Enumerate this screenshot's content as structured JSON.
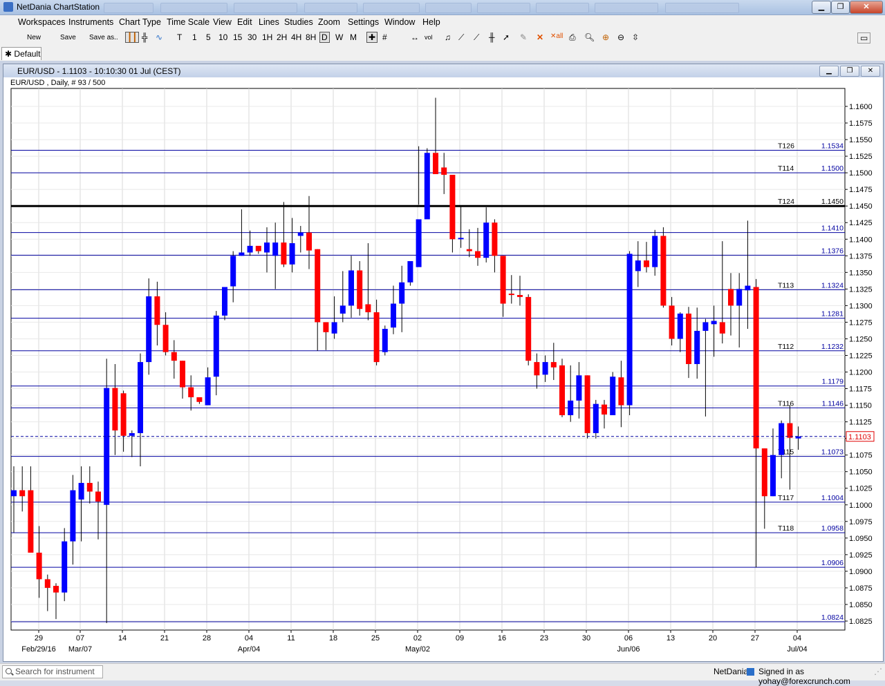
{
  "app": {
    "title": "NetDania ChartStation"
  },
  "menu": [
    "Workspaces",
    "Instruments",
    "Chart Type",
    "Time Scale",
    "View",
    "Edit",
    "Lines",
    "Studies",
    "Zoom",
    "Settings",
    "Window",
    "Help"
  ],
  "toolbar": {
    "new_label": "New",
    "save_label": "Save",
    "saveas_label": "Save as..",
    "periods": [
      "T",
      "1",
      "5",
      "10",
      "15",
      "30",
      "1H",
      "2H",
      "4H",
      "8H",
      "D",
      "W",
      "M"
    ],
    "selected_period": "D"
  },
  "workspace_tab": {
    "icon": "✱",
    "label": "Default"
  },
  "chart_window": {
    "title": "EUR/USD - 1.1103 - 10:10:30  01 Jul (CEST)",
    "subtitle": "EUR/USD , Daily, # 93 / 500"
  },
  "chart_data": {
    "type": "candlestick",
    "instrument": "EUR/USD",
    "ylim": [
      1.0815,
      1.1625
    ],
    "y_ticks": [
      "1.1600",
      "1.1575",
      "1.1550",
      "1.1525",
      "1.1500",
      "1.1475",
      "1.1450",
      "1.1425",
      "1.1400",
      "1.1375",
      "1.1350",
      "1.1325",
      "1.1300",
      "1.1275",
      "1.1250",
      "1.1225",
      "1.1200",
      "1.1175",
      "1.1150",
      "1.1125",
      "1.1100",
      "1.1075",
      "1.1050",
      "1.1025",
      "1.1000",
      "1.0975",
      "1.0950",
      "1.0925",
      "1.0900",
      "1.0875",
      "1.0850",
      "1.0825"
    ],
    "x_ticks": [
      "29",
      "07",
      "14",
      "21",
      "28",
      "04",
      "11",
      "18",
      "25",
      "02",
      "09",
      "16",
      "23",
      "30",
      "06",
      "13",
      "20",
      "27",
      "04"
    ],
    "x_sublabels": [
      {
        "at": "29",
        "text": "Feb/29/16"
      },
      {
        "at": "07",
        "text": "Mar/07"
      },
      {
        "at": "04",
        "text": "Apr/04"
      },
      {
        "at": "02",
        "text": "May/02"
      },
      {
        "at": "06",
        "text": "Jun/06"
      },
      {
        "at": "04b",
        "text": "Jul/04"
      }
    ],
    "last_price": "1.1103",
    "colors": {
      "up": "#0000ff",
      "down": "#ff0000",
      "line": "#0000a0",
      "bold_line": "#000000"
    },
    "hlines": [
      {
        "price": 1.1534,
        "label": "1.1534",
        "tag": "T126"
      },
      {
        "price": 1.15,
        "label": "1.1500",
        "tag": "T114"
      },
      {
        "price": 1.145,
        "label": "1.1450",
        "tag": "T124",
        "bold": true
      },
      {
        "price": 1.141,
        "label": "1.1410",
        "tag": ""
      },
      {
        "price": 1.1376,
        "label": "1.1376",
        "tag": ""
      },
      {
        "price": 1.1324,
        "label": "1.1324",
        "tag": "T113"
      },
      {
        "price": 1.1281,
        "label": "1.1281",
        "tag": ""
      },
      {
        "price": 1.1232,
        "label": "1.1232",
        "tag": "T112"
      },
      {
        "price": 1.1179,
        "label": "1.1179",
        "tag": ""
      },
      {
        "price": 1.1146,
        "label": "1.1146",
        "tag": "T116"
      },
      {
        "price": 1.1073,
        "label": "1.1073",
        "tag": "T115"
      },
      {
        "price": 1.1004,
        "label": "1.1004",
        "tag": "T117"
      },
      {
        "price": 1.0958,
        "label": "1.0958",
        "tag": "T118"
      },
      {
        "price": 1.0906,
        "label": "1.0906",
        "tag": ""
      },
      {
        "price": 1.0824,
        "label": "1.0824",
        "tag": ""
      }
    ],
    "candles": [
      [
        1.1013,
        1.1058,
        1.0958,
        1.1022
      ],
      [
        1.1022,
        1.1058,
        1.099,
        1.1013
      ],
      [
        1.1022,
        1.1058,
        1.093,
        1.0928
      ],
      [
        1.0928,
        1.0968,
        1.086,
        1.0888
      ],
      [
        1.0888,
        1.0895,
        1.084,
        1.0875
      ],
      [
        1.0878,
        1.0882,
        1.0828,
        1.0868
      ],
      [
        1.0868,
        1.0965,
        1.0855,
        1.0945
      ],
      [
        1.0945,
        1.1045,
        1.091,
        1.1022
      ],
      [
        1.1008,
        1.1058,
        1.0945,
        1.1033
      ],
      [
        1.1033,
        1.1058,
        1.1002,
        1.102
      ],
      [
        1.102,
        1.1035,
        1.0948,
        1.1005
      ],
      [
        1.1,
        1.122,
        1.0822,
        1.1176
      ],
      [
        1.1176,
        1.1212,
        1.1075,
        1.1112
      ],
      [
        1.1168,
        1.1172,
        1.108,
        1.1104
      ],
      [
        1.1104,
        1.1112,
        1.1072,
        1.1108
      ],
      [
        1.1108,
        1.1228,
        1.1058,
        1.1215
      ],
      [
        1.1215,
        1.1341,
        1.1196,
        1.1314
      ],
      [
        1.1314,
        1.1336,
        1.124,
        1.1271
      ],
      [
        1.1271,
        1.129,
        1.1225,
        1.123
      ],
      [
        1.123,
        1.1248,
        1.119,
        1.1217
      ],
      [
        1.1217,
        1.1217,
        1.116,
        1.1177
      ],
      [
        1.1177,
        1.1195,
        1.1142,
        1.1162
      ],
      [
        1.1162,
        1.1158,
        1.1152,
        1.1155
      ],
      [
        1.115,
        1.1207,
        1.115,
        1.1192
      ],
      [
        1.1193,
        1.1292,
        1.1165,
        1.1285
      ],
      [
        1.1285,
        1.1325,
        1.1278,
        1.1328
      ],
      [
        1.1329,
        1.1382,
        1.1305,
        1.1375
      ],
      [
        1.1375,
        1.1445,
        1.1375,
        1.138
      ],
      [
        1.138,
        1.1413,
        1.1375,
        1.139
      ],
      [
        1.139,
        1.1385,
        1.1378,
        1.1382
      ],
      [
        1.138,
        1.1418,
        1.135,
        1.1395
      ],
      [
        1.1375,
        1.1425,
        1.1325,
        1.1395
      ],
      [
        1.1395,
        1.1456,
        1.1358,
        1.1362
      ],
      [
        1.1362,
        1.1432,
        1.135,
        1.1394
      ],
      [
        1.1405,
        1.142,
        1.138,
        1.141
      ],
      [
        1.141,
        1.1465,
        1.1355,
        1.1383
      ],
      [
        1.1385,
        1.1385,
        1.1232,
        1.1275
      ],
      [
        1.1275,
        1.1275,
        1.1233,
        1.126
      ],
      [
        1.1258,
        1.1314,
        1.125,
        1.1275
      ],
      [
        1.1288,
        1.1352,
        1.1275,
        1.13
      ],
      [
        1.13,
        1.1375,
        1.1282,
        1.1353
      ],
      [
        1.1353,
        1.1367,
        1.1285,
        1.1295
      ],
      [
        1.1302,
        1.1394,
        1.1278,
        1.129
      ],
      [
        1.129,
        1.1309,
        1.121,
        1.1215
      ],
      [
        1.123,
        1.127,
        1.1225,
        1.1265
      ],
      [
        1.1267,
        1.133,
        1.1257,
        1.1303
      ],
      [
        1.1303,
        1.136,
        1.126,
        1.1335
      ],
      [
        1.1335,
        1.1367,
        1.133,
        1.1367
      ],
      [
        1.1358,
        1.154,
        1.1452,
        1.143
      ],
      [
        1.143,
        1.1537,
        1.1452,
        1.153
      ],
      [
        1.153,
        1.1613,
        1.153,
        1.1498
      ],
      [
        1.1508,
        1.153,
        1.1468,
        1.1497
      ],
      [
        1.1497,
        1.1488,
        1.138,
        1.14
      ],
      [
        1.14,
        1.145,
        1.1387,
        1.1402
      ],
      [
        1.1385,
        1.1415,
        1.1373,
        1.1382
      ],
      [
        1.1382,
        1.1417,
        1.136,
        1.1372
      ],
      [
        1.1372,
        1.1448,
        1.1365,
        1.1425
      ],
      [
        1.1425,
        1.143,
        1.135,
        1.1375
      ],
      [
        1.1375,
        1.1375,
        1.1283,
        1.1303
      ],
      [
        1.1318,
        1.1346,
        1.1303,
        1.1316
      ],
      [
        1.1316,
        1.1345,
        1.13,
        1.1313
      ],
      [
        1.1313,
        1.1317,
        1.121,
        1.1217
      ],
      [
        1.1215,
        1.1228,
        1.1175,
        1.1195
      ],
      [
        1.1196,
        1.1225,
        1.1185,
        1.1215
      ],
      [
        1.1215,
        1.1244,
        1.1188,
        1.1207
      ],
      [
        1.121,
        1.122,
        1.1132,
        1.1135
      ],
      [
        1.1135,
        1.121,
        1.1125,
        1.1157
      ],
      [
        1.1157,
        1.1215,
        1.113,
        1.1195
      ],
      [
        1.1195,
        1.1195,
        1.11,
        1.1108
      ],
      [
        1.1108,
        1.1158,
        1.11,
        1.1152
      ],
      [
        1.1151,
        1.1158,
        1.1115,
        1.1136
      ],
      [
        1.1135,
        1.12,
        1.1135,
        1.1193
      ],
      [
        1.1192,
        1.1217,
        1.1117,
        1.115
      ],
      [
        1.115,
        1.1382,
        1.1135,
        1.1378
      ],
      [
        1.1352,
        1.1397,
        1.1328,
        1.1368
      ],
      [
        1.1368,
        1.1396,
        1.135,
        1.1358
      ],
      [
        1.1358,
        1.1414,
        1.1345,
        1.1405
      ],
      [
        1.1405,
        1.1418,
        1.1297,
        1.13
      ],
      [
        1.13,
        1.1313,
        1.124,
        1.125
      ],
      [
        1.125,
        1.129,
        1.123,
        1.1288
      ],
      [
        1.1288,
        1.1298,
        1.1191,
        1.1212
      ],
      [
        1.1212,
        1.1297,
        1.119,
        1.1262
      ],
      [
        1.1262,
        1.128,
        1.1133,
        1.1275
      ],
      [
        1.1272,
        1.13,
        1.1223,
        1.1277
      ],
      [
        1.1275,
        1.1397,
        1.1243,
        1.1258
      ],
      [
        1.1325,
        1.1349,
        1.1255,
        1.13
      ],
      [
        1.13,
        1.1349,
        1.1237,
        1.1325
      ],
      [
        1.1323,
        1.1428,
        1.1265,
        1.133
      ],
      [
        1.1328,
        1.134,
        1.0906,
        1.1085
      ],
      [
        1.1085,
        1.1085,
        1.0964,
        1.1013
      ],
      [
        1.1013,
        1.1115,
        1.1013,
        1.1075
      ],
      [
        1.1075,
        1.1127,
        1.104,
        1.1123
      ],
      [
        1.1123,
        1.115,
        1.1023,
        1.1101
      ],
      [
        1.11,
        1.1118,
        1.1083,
        1.1103
      ]
    ]
  },
  "statusbar": {
    "search_placeholder": "Search for instrument",
    "brand": "NetDania",
    "signed_in": "Signed in as yohay@forexcrunch.com"
  }
}
